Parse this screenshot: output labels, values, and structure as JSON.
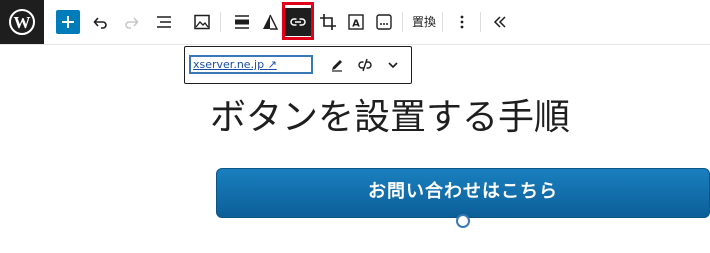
{
  "toolbar": {
    "logo_icon": "wordpress-logo",
    "add_icon": "plus-icon",
    "undo_icon": "undo-icon",
    "redo_icon": "redo-icon",
    "list_view_icon": "list-view-icon",
    "image_icon": "image-icon",
    "align_icon": "align-icon",
    "duotone_icon": "duotone-icon",
    "link_icon": "link-icon",
    "crop_icon": "crop-icon",
    "text_overlay_icon": "text-overlay-icon",
    "more_inline_icon": "ellipsis-box-icon",
    "replace_label": "置換",
    "options_icon": "vertical-dots-icon",
    "collapse_icon": "double-chevron-left-icon",
    "highlight_color": "#e0001a"
  },
  "link_popover": {
    "url": "xserver.ne.jp ↗",
    "edit_icon": "pencil-icon",
    "unlink_icon": "unlink-icon",
    "expand_icon": "chevron-down-icon"
  },
  "content": {
    "heading": "ボタンを設置する手順",
    "button_label": "お問い合わせはこちら",
    "button_color": "#0e6aa8"
  }
}
